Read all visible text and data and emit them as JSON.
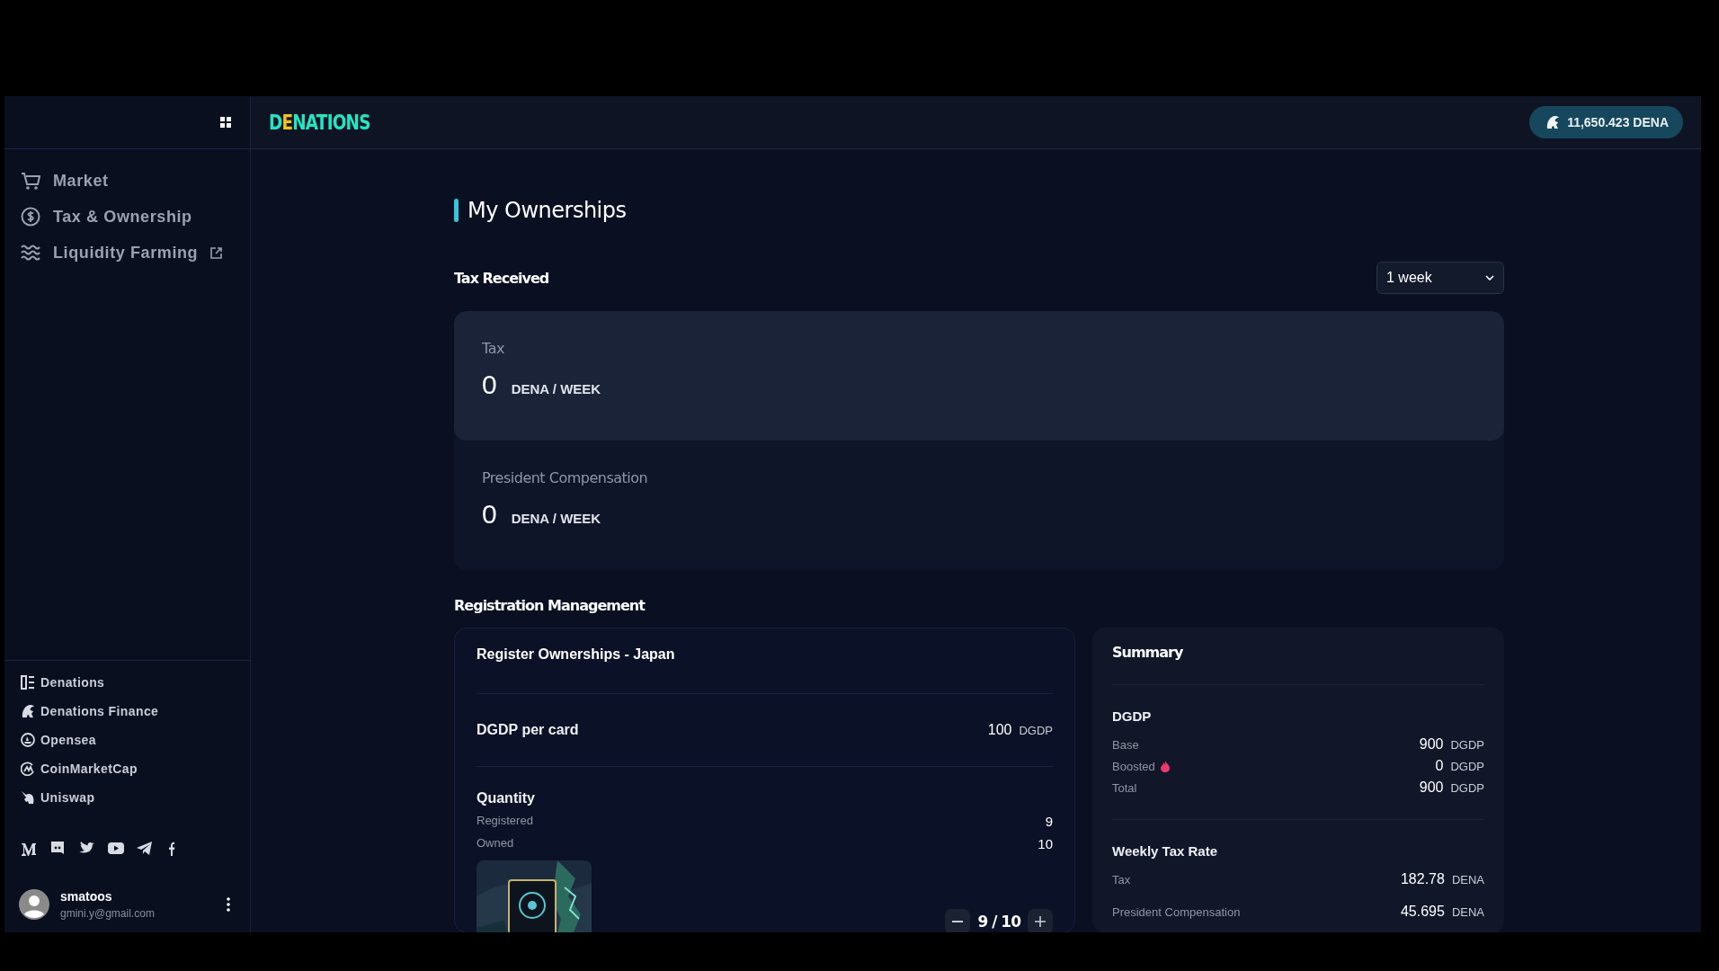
{
  "sidebar": {
    "nav": [
      {
        "label": "Market",
        "external": false
      },
      {
        "label": "Tax & Ownership",
        "external": false
      },
      {
        "label": "Liquidity Farming",
        "external": true
      }
    ],
    "links": [
      {
        "label": "Denations"
      },
      {
        "label": "Denations Finance"
      },
      {
        "label": "Opensea"
      },
      {
        "label": "CoinMarketCap"
      },
      {
        "label": "Uniswap"
      }
    ],
    "user": {
      "name": "smatoos",
      "email": "gmini.y@gmail.com"
    }
  },
  "header": {
    "logo": "DENATIONS",
    "balance": "11,650.423 DENA"
  },
  "page_title": "My Ownerships",
  "tax_received": {
    "title": "Tax Received",
    "period": "1 week",
    "cards": [
      {
        "label": "Tax",
        "value": "0",
        "unit": "DENA / WEEK",
        "highlighted": true
      },
      {
        "label": "President Compensation",
        "value": "0",
        "unit": "DENA / WEEK",
        "highlighted": false
      }
    ]
  },
  "registration": {
    "title": "Registration Management",
    "card": {
      "title": "Register Ownerships - Japan",
      "per_card": {
        "label": "DGDP per card",
        "value": "100",
        "unit": "DGDP"
      },
      "quantity": {
        "title": "Quantity",
        "rows": [
          {
            "label": "Registered",
            "value": "9"
          },
          {
            "label": "Owned",
            "value": "10"
          }
        ]
      },
      "stepper": "9 / 10"
    },
    "summary": {
      "title": "Summary",
      "sections": [
        {
          "title": "DGDP",
          "rows": [
            {
              "label": "Base",
              "value": "900",
              "unit": "DGDP",
              "flame": false
            },
            {
              "label": "Boosted",
              "value": "0",
              "unit": "DGDP",
              "flame": true
            },
            {
              "label": "Total",
              "value": "900",
              "unit": "DGDP",
              "flame": false
            }
          ]
        },
        {
          "title": "Weekly Tax Rate",
          "rows": [
            {
              "label": "Tax",
              "value": "182.78",
              "unit": "DENA",
              "flame": false
            },
            {
              "label": "President Compensation",
              "value": "45.695",
              "unit": "DENA",
              "flame": false
            }
          ]
        }
      ]
    }
  }
}
